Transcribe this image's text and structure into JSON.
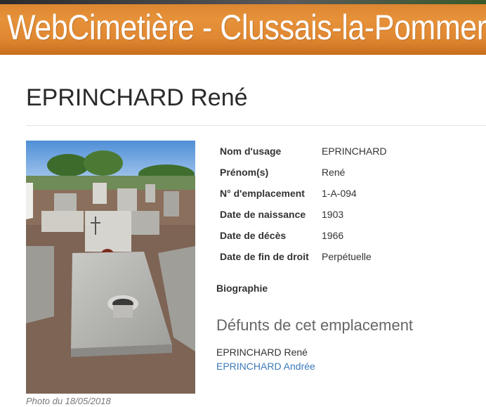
{
  "banner": {
    "title": "WebCimetière - Clussais-la-Pommeraie"
  },
  "page": {
    "title": "EPRINCHARD René"
  },
  "photo": {
    "caption": "Photo du 18/05/2018"
  },
  "details": [
    {
      "label": "Nom d'usage",
      "value": "EPRINCHARD"
    },
    {
      "label": "Prénom(s)",
      "value": "René"
    },
    {
      "label": "N° d'emplacement",
      "value": "1-A-094"
    },
    {
      "label": "Date de naissance",
      "value": "1903"
    },
    {
      "label": "Date de décès",
      "value": "1966"
    },
    {
      "label": "Date de fin de droit",
      "value": "Perpétuelle"
    }
  ],
  "biography": {
    "label": "Biographie"
  },
  "deceased": {
    "heading": "Défunts de cet emplacement",
    "people": [
      {
        "name": "EPRINCHARD René",
        "link": false
      },
      {
        "name": "EPRINCHARD Andrée",
        "link": true
      }
    ]
  },
  "colors": {
    "banner": "#e08732",
    "link": "#3a7ab8"
  }
}
